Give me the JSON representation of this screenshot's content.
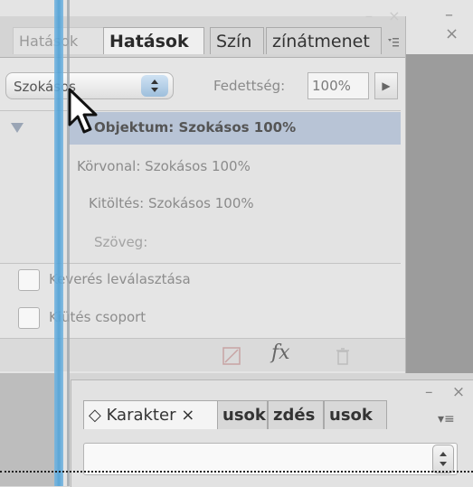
{
  "effects_panel": {
    "tabs": {
      "ghost": "Hatások",
      "effects": "Hatások",
      "color": "Szín",
      "gradient": "zínátmenet"
    },
    "window_controls": "– ×",
    "blend_mode": {
      "value": "Szokásos",
      "arrow": "▴▾"
    },
    "opacity": {
      "label": "Fedettség:",
      "value": "100%",
      "arrow": "▶"
    },
    "targets": {
      "object": "Objektum: Szokásos 100%",
      "stroke": "Körvonal: Szokásos 100%",
      "fill": "Kitöltés: Szokásos 100%",
      "text": "Szöveg:"
    },
    "checkboxes": {
      "isolate": "Keverés leválasztása",
      "knockout": "Kiütés csoport"
    },
    "fx_label": "fx"
  },
  "character_panel": {
    "tabs": {
      "character": "◇ Karakter ×",
      "tab2": "usok",
      "tab3": "zdés",
      "tab4": "usok"
    },
    "window_controls": "– ×",
    "menu_icon": "▾≡",
    "select_arrow": "▴\n▾"
  },
  "colors": {
    "guide": "#4b9fd6",
    "selection": "#b8c4d6"
  }
}
